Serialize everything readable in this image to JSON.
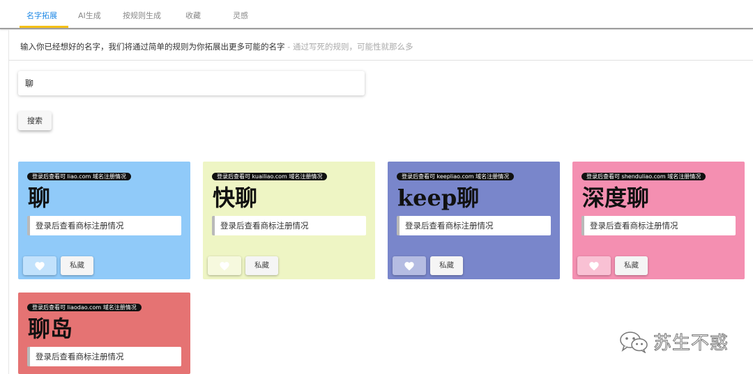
{
  "tabs": [
    {
      "label": "名字拓展",
      "active": true
    },
    {
      "label": "AI生成"
    },
    {
      "label": "按规则生成"
    },
    {
      "label": "收藏"
    },
    {
      "label": "灵感"
    }
  ],
  "description": {
    "main": "输入你已经想好的名字，我们将通过简单的规则为你拓展出更多可能的名字",
    "hint": " - 通过写死的规则，可能性就那么多"
  },
  "search": {
    "value": "聊",
    "button_label": "搜索"
  },
  "cards": [
    {
      "domain_tag": "登录后查看可 liao.com 域名注册情况",
      "name": "聊",
      "trademark": "登录后查看商标注册情况",
      "fav_label": "私藏",
      "color": "#90caf9"
    },
    {
      "domain_tag": "登录后查看可 kuailiao.com 域名注册情况",
      "name": "快聊",
      "trademark": "登录后查看商标注册情况",
      "fav_label": "私藏",
      "color": "#eef5c4"
    },
    {
      "domain_tag": "登录后查看可 keepliao.com 域名注册情况",
      "name": "keep聊",
      "trademark": "登录后查看商标注册情况",
      "fav_label": "私藏",
      "color": "#7986cb"
    },
    {
      "domain_tag": "登录后查看可 shenduliao.com 域名注册情况",
      "name": "深度聊",
      "trademark": "登录后查看商标注册情况",
      "fav_label": "私藏",
      "color": "#f48fb1"
    },
    {
      "domain_tag": "登录后查看可 liaodao.com 域名注册情况",
      "name": "聊岛",
      "trademark": "登录后查看商标注册情况",
      "color": "#e57373"
    }
  ],
  "watermark": {
    "text": "苏生不惑",
    "icon": "wechat-icon"
  },
  "colors": {
    "accent": "#1e88e5",
    "tab_underline": "#f5c016"
  }
}
